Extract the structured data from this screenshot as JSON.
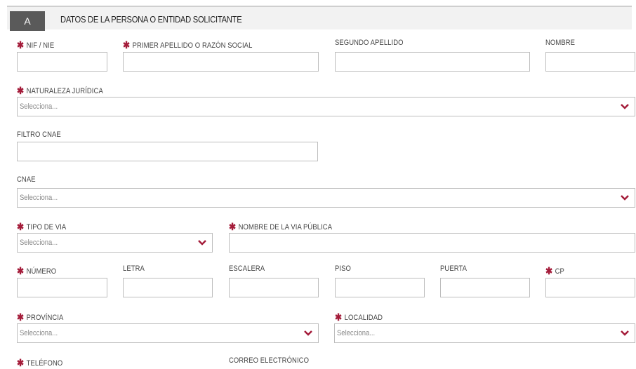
{
  "section": {
    "badge": "A",
    "title": "DATOS DE LA PERSONA O ENTIDAD SOLICITANTE"
  },
  "required_mark": "✱",
  "fields": {
    "nif": {
      "label": "NIF / NIE",
      "value": ""
    },
    "primer_apellido": {
      "label": "PRIMER APELLIDO O RAZÓN SOCIAL",
      "value": ""
    },
    "segundo_apellido": {
      "label": "SEGUNDO APELLIDO",
      "value": ""
    },
    "nombre": {
      "label": "NOMBRE",
      "value": ""
    },
    "naturaleza": {
      "label": "NATURALEZA JURÍDICA",
      "placeholder": "Selecciona..."
    },
    "filtro_cnae": {
      "label": "FILTRO CNAE",
      "value": ""
    },
    "cnae": {
      "label": "CNAE",
      "placeholder": "Selecciona..."
    },
    "tipo_via": {
      "label": "TIPO DE VIA",
      "placeholder": "Selecciona..."
    },
    "nombre_via": {
      "label": "NOMBRE DE LA VIA PÚBLICA",
      "value": ""
    },
    "numero": {
      "label": "NÚMERO",
      "value": ""
    },
    "letra": {
      "label": "LETRA",
      "value": ""
    },
    "escalera": {
      "label": "ESCALERA",
      "value": ""
    },
    "piso": {
      "label": "PISO",
      "value": ""
    },
    "puerta": {
      "label": "PUERTA",
      "value": ""
    },
    "cp": {
      "label": "CP",
      "value": ""
    },
    "provincia": {
      "label": "PROVÍNCIA",
      "placeholder": "Selecciona..."
    },
    "localidad": {
      "label": "LOCALIDAD",
      "placeholder": "Selecciona..."
    },
    "telefono": {
      "label": "TELÉFONO"
    },
    "correo": {
      "label": "CORREO ELECTRÓNICO"
    }
  },
  "colors": {
    "required": "#a41c3a",
    "chevron": "#a41c3a",
    "badge": "#5a5a5a"
  },
  "icons": {
    "dropdown": "chevron-down-icon"
  }
}
